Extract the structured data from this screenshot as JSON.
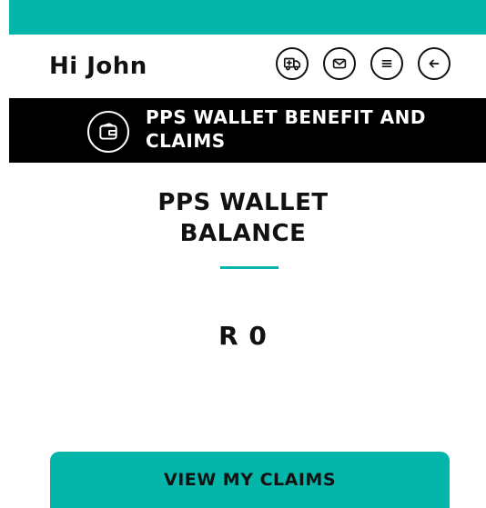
{
  "header": {
    "greeting": "Hi John",
    "icons": [
      "ambulance-icon",
      "mail-icon",
      "menu-icon",
      "back-arrow-icon"
    ]
  },
  "section": {
    "icon": "wallet-icon",
    "title": "PPS WALLET BENEFIT AND\nCLAIMS"
  },
  "balance": {
    "title": "PPS WALLET\nBALANCE",
    "amount": "R 0"
  },
  "actions": {
    "view_claims_label": "VIEW MY CLAIMS"
  },
  "colors": {
    "accent": "#04b5aa",
    "band": "#000000",
    "text": "#111111",
    "background": "#ffffff"
  }
}
